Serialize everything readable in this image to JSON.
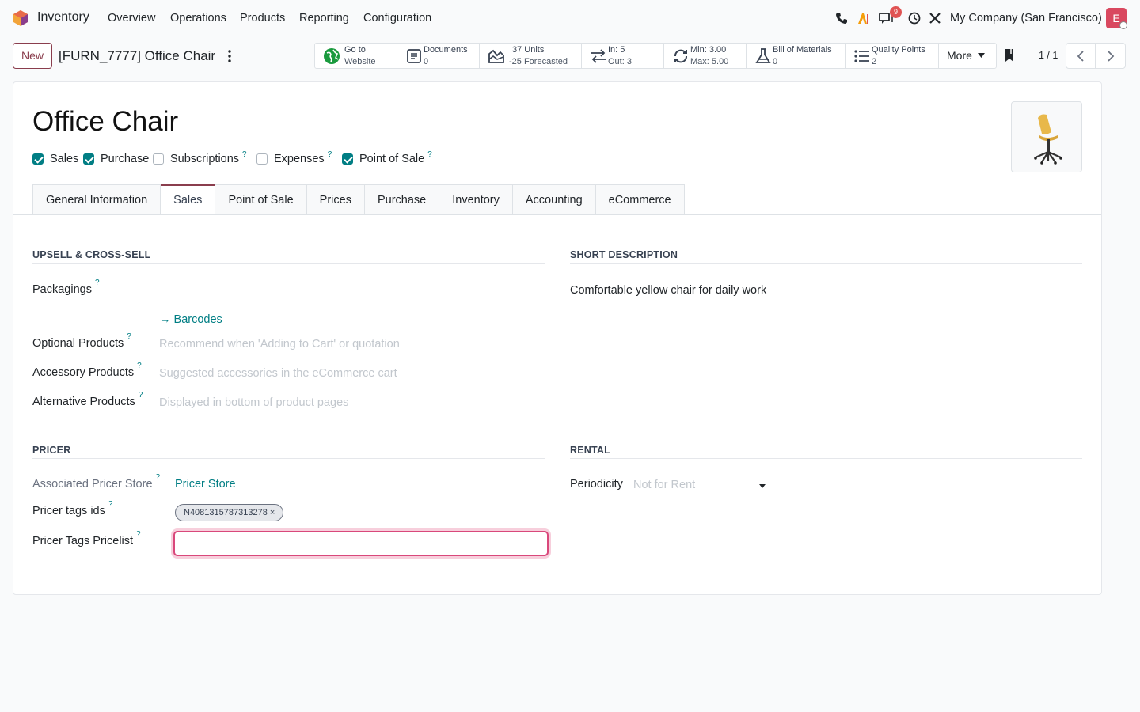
{
  "navbar": {
    "app_name": "Inventory",
    "menus": [
      "Overview",
      "Operations",
      "Products",
      "Reporting",
      "Configuration"
    ],
    "chat_badge": "9",
    "company": "My Company (San Francisco)",
    "avatar_letter": "E",
    "icons": [
      "phone-icon",
      "ai-icon",
      "chat-icon",
      "clock-icon",
      "tools-icon"
    ]
  },
  "control": {
    "new_label": "New",
    "breadcrumb": "[FURN_7777] Office Chair",
    "smart_buttons": [
      {
        "l1": "Go to",
        "l2": "Website",
        "icon": "globe-icon"
      },
      {
        "l1": "Documents",
        "l2": "0",
        "icon": "document-icon"
      },
      {
        "l1": "37 Units",
        "l2": "-25 Forecasted",
        "icon": "forecast-icon"
      },
      {
        "l1": "In: 5",
        "l2": "Out: 3",
        "icon": "transfer-icon"
      },
      {
        "l1": "Min: 3.00",
        "l2": "Max: 5.00",
        "icon": "refresh-icon"
      },
      {
        "l1": "Bill of Materials",
        "l2": "0",
        "icon": "flask-icon"
      },
      {
        "l1": "Quality Points",
        "l2": "2",
        "icon": "list-icon"
      }
    ],
    "more_label": "More",
    "pager": "1 / 1"
  },
  "product": {
    "name": "Office Chair",
    "checkboxes": [
      {
        "label": "Sales",
        "checked": true
      },
      {
        "label": "Purchase",
        "checked": true
      },
      {
        "label": "Subscriptions",
        "checked": false
      },
      {
        "label": "Expenses",
        "checked": false
      },
      {
        "label": "Point of Sale",
        "checked": true
      }
    ],
    "help_mark": "?"
  },
  "tabs": [
    "General Information",
    "Sales",
    "Point of Sale",
    "Prices",
    "Purchase",
    "Inventory",
    "Accounting",
    "eCommerce"
  ],
  "active_tab": "Sales",
  "upsell": {
    "title": "UPSELL & CROSS-SELL",
    "packagings_label": "Packagings",
    "barcodes_link": "→ Barcodes",
    "optional_label": "Optional Products",
    "optional_placeholder": "Recommend when 'Adding to Cart' or quotation",
    "accessory_label": "Accessory Products",
    "accessory_placeholder": "Suggested accessories in the eCommerce cart",
    "alternative_label": "Alternative Products",
    "alternative_placeholder": "Displayed in bottom of product pages"
  },
  "short_description": {
    "title": "SHORT DESCRIPTION",
    "text": "Comfortable yellow chair for daily work"
  },
  "pricer": {
    "title": "PRICER",
    "store_label": "Associated Pricer Store",
    "store_value": "Pricer Store",
    "tags_label": "Pricer tags ids",
    "tag_value": "N4081315787313278",
    "tag_remove": "×",
    "pricelist_label": "Pricer Tags Pricelist"
  },
  "rental": {
    "title": "RENTAL",
    "periodicity_label": "Periodicity",
    "periodicity_placeholder": "Not for Rent"
  },
  "colors": {
    "accent": "#8a3d4d",
    "link": "#017e84",
    "focus": "#d9487b"
  }
}
